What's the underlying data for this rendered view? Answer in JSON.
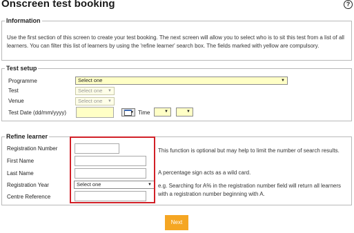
{
  "page": {
    "title": "Onscreen test booking",
    "help_symbol": "?"
  },
  "information": {
    "legend": "Information",
    "text": "Use the first section of this screen to create your test booking. The next screen will allow you to select who is to sit this test from a list of all learners. You can filter this list of learners by using the 'refine learner' search box. The fields marked with yellow are compulsory."
  },
  "test_setup": {
    "legend": "Test setup",
    "programme_label": "Programme",
    "programme_value": "Select one",
    "test_label": "Test",
    "test_value": "Select one",
    "venue_label": "Venue",
    "venue_value": "Select one",
    "date_label": "Test Date (dd/mm/yyyy)",
    "date_value": "",
    "time_label": "Time",
    "hour_value": "",
    "minute_value": ""
  },
  "refine_learner": {
    "legend": "Refine learner",
    "registration_number_label": "Registration Number",
    "first_name_label": "First Name",
    "last_name_label": "Last Name",
    "registration_year_label": "Registration Year",
    "registration_year_value": "Select one",
    "centre_reference_label": "Centre Reference",
    "help_text_1": "This function is optional but may help to limit the number of search results.",
    "help_text_2": "A percentage sign acts as a wild card.",
    "help_text_3": "e.g. Searching for A% in the registration number field will return all learners with a registration number beginning with A."
  },
  "actions": {
    "next_label": "Next"
  },
  "colors": {
    "compulsory_field": "#ffffc6",
    "highlight": "#d11f26",
    "next_button": "#f5a623"
  },
  "icons": {
    "help": "help-icon",
    "calendar": "calendar-icon",
    "dropdown": "chevron-down-icon"
  }
}
